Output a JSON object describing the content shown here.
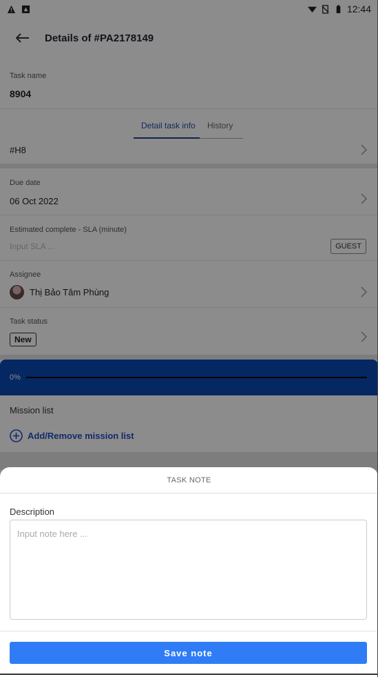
{
  "status_bar": {
    "time": "12:44"
  },
  "app_bar": {
    "title": "Details of #PA2178149"
  },
  "task_name": {
    "label": "Task name",
    "value": "8904"
  },
  "tabs": [
    {
      "label": "Detail task info",
      "active": true
    },
    {
      "label": "History",
      "active": false
    }
  ],
  "group": {
    "value": "#H8"
  },
  "due_date": {
    "label": "Due date",
    "value": "06 Oct 2022"
  },
  "sla": {
    "label": "Estimated complete - SLA (minute)",
    "placeholder": "Input SLA ...",
    "badge": "GUEST"
  },
  "assignee": {
    "label": "Assignee",
    "value": "Thị Bảo Tâm Phùng"
  },
  "task_status": {
    "label": "Task status",
    "value": "New"
  },
  "progress": {
    "value_text": "0%",
    "value": 0
  },
  "mission": {
    "title": "Mission list",
    "add_label": "Add/Remove mission list"
  },
  "sheet": {
    "title": "TASK NOTE",
    "description_label": "Description",
    "placeholder": "Input note here ...",
    "save_label": "Save note"
  },
  "colors": {
    "primary": "#2f7cf6",
    "progress_bg": "#0a49b5",
    "tab_active": "#1f4fa8"
  }
}
